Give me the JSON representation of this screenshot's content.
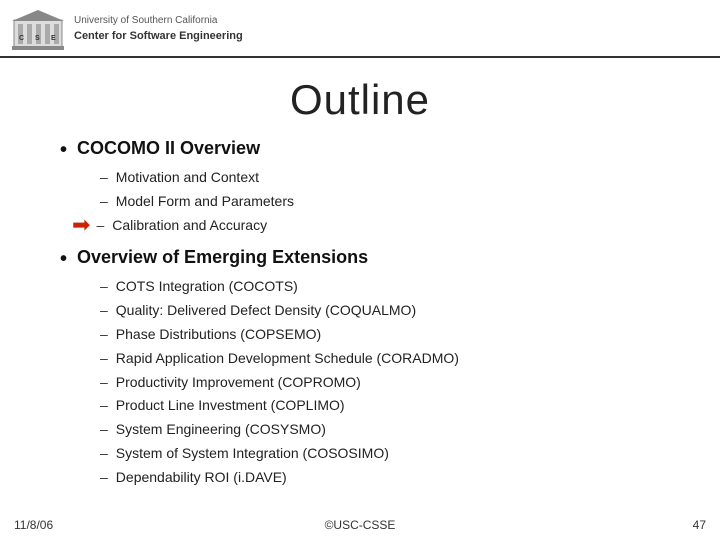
{
  "header": {
    "university": "University of Southern California",
    "center": "Center for Software  Engineering"
  },
  "title": "Outline",
  "sections": [
    {
      "id": "section1",
      "label": "COCOMO II Overview",
      "sub_items": [
        {
          "text": "Motivation and Context",
          "arrow": false
        },
        {
          "text": "Model Form and Parameters",
          "arrow": false
        },
        {
          "text": "Calibration and Accuracy",
          "arrow": true
        }
      ]
    },
    {
      "id": "section2",
      "label": "Overview of Emerging Extensions",
      "sub_items": [
        {
          "text": "COTS Integration (COCOTS)",
          "arrow": false
        },
        {
          "text": "Quality: Delivered Defect Density (COQUALMO)",
          "arrow": false
        },
        {
          "text": "Phase Distributions (COPSEMO)",
          "arrow": false
        },
        {
          "text": "Rapid Application Development Schedule (CORADMO)",
          "arrow": false
        },
        {
          "text": "Productivity Improvement (COPROMO)",
          "arrow": false
        },
        {
          "text": "Product Line Investment (COPLIMO)",
          "arrow": false
        },
        {
          "text": "System Engineering (COSYSMO)",
          "arrow": false
        },
        {
          "text": "System of System Integration (COSOSIMO)",
          "arrow": false
        },
        {
          "text": "Dependability ROI (i.DAVE)",
          "arrow": false
        }
      ]
    }
  ],
  "footer": {
    "date": "11/8/06",
    "copyright": "©USC-CSSE",
    "page": "47"
  }
}
